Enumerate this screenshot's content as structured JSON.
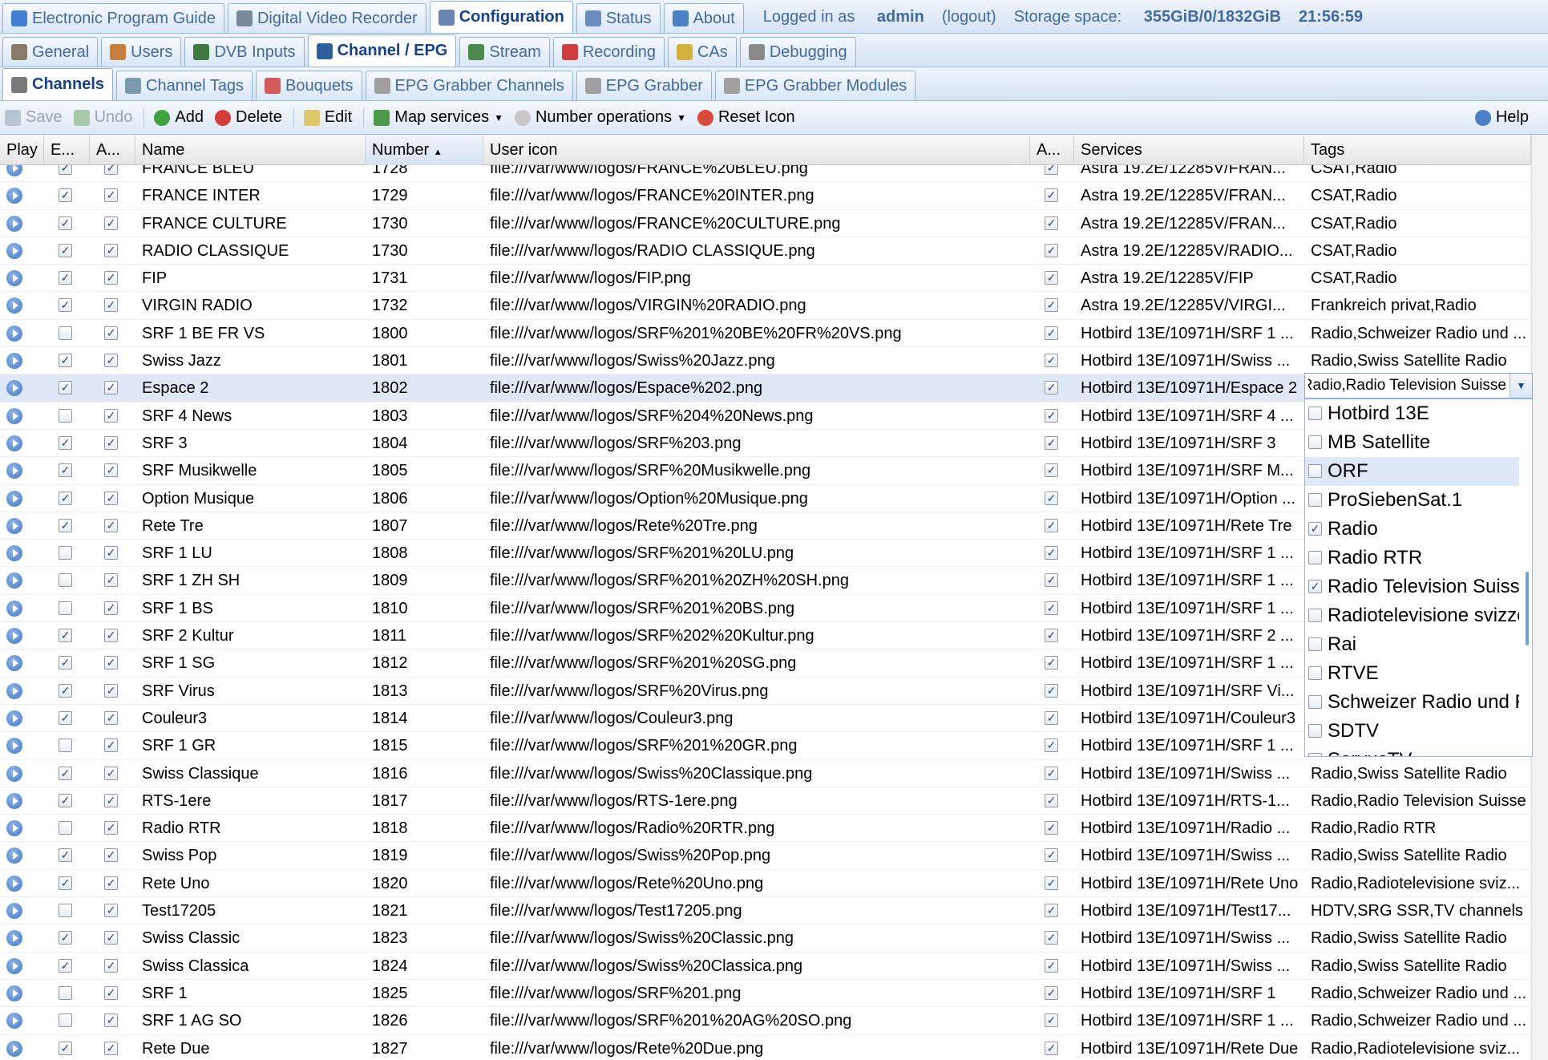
{
  "top_tabs": [
    {
      "label": "Electronic Program Guide",
      "icon": "epg-icon",
      "color": "#3f7fd4",
      "active": false
    },
    {
      "label": "Digital Video Recorder",
      "icon": "dvr-icon",
      "color": "#7a8a9a",
      "active": false
    },
    {
      "label": "Configuration",
      "icon": "wrench-icon",
      "color": "#6b85b5",
      "active": true
    },
    {
      "label": "Status",
      "icon": "eye-icon",
      "color": "#6a8cc0",
      "active": false
    },
    {
      "label": "About",
      "icon": "info-icon",
      "color": "#4a80c8",
      "active": false
    }
  ],
  "session": {
    "logged_in_prefix": "Logged in as",
    "user": "admin",
    "logout": "(logout)",
    "storage_label": "Storage space:",
    "storage_value": "355GiB/0/1832GiB",
    "time": "21:56:59"
  },
  "config_tabs": [
    {
      "label": "General",
      "icon": "tools-icon",
      "color": "#8a7a6a",
      "active": false
    },
    {
      "label": "Users",
      "icon": "users-icon",
      "color": "#c6803c",
      "active": false
    },
    {
      "label": "DVB Inputs",
      "icon": "dvb-icon",
      "color": "#3d7a3d",
      "active": false
    },
    {
      "label": "Channel / EPG",
      "icon": "tv-icon",
      "color": "#2d5f9a",
      "active": true
    },
    {
      "label": "Stream",
      "icon": "stream-icon",
      "color": "#4d8a4d",
      "active": false
    },
    {
      "label": "Recording",
      "icon": "rec-icon",
      "color": "#d43d3d",
      "active": false
    },
    {
      "label": "CAs",
      "icon": "key-icon",
      "color": "#d4b03d",
      "active": false
    },
    {
      "label": "Debugging",
      "icon": "bug-icon",
      "color": "#8a8a8a",
      "active": false
    }
  ],
  "channel_tabs": [
    {
      "label": "Channels",
      "icon": "remote-icon",
      "color": "#7a7a7a",
      "active": true
    },
    {
      "label": "Channel Tags",
      "icon": "tag-icon",
      "color": "#7a9ab0",
      "active": false
    },
    {
      "label": "Bouquets",
      "icon": "bouquet-icon",
      "color": "#d45a5a",
      "active": false
    },
    {
      "label": "EPG Grabber Channels",
      "icon": "grabber-icon",
      "color": "#a0a0a0",
      "active": false
    },
    {
      "label": "EPG Grabber",
      "icon": "grabber-icon",
      "color": "#a0a0a0",
      "active": false
    },
    {
      "label": "EPG Grabber Modules",
      "icon": "grabber-icon",
      "color": "#a0a0a0",
      "active": false
    }
  ],
  "toolbar": {
    "save": "Save",
    "undo": "Undo",
    "add": "Add",
    "delete": "Delete",
    "edit": "Edit",
    "map": "Map services",
    "number_ops": "Number operations",
    "reset_icon": "Reset Icon",
    "help": "Help"
  },
  "columns": {
    "play": "Play",
    "enabled": "E...",
    "autoname": "A...",
    "name": "Name",
    "number": "Number",
    "icon": "User icon",
    "auto_icon": "A...",
    "services": "Services",
    "tags": "Tags"
  },
  "rows": [
    {
      "e": true,
      "a": true,
      "name": "FRANCE BLEU",
      "num": "1728",
      "icon": "file:///var/www/logos/FRANCE%20BLEU.png",
      "ai": true,
      "svc": "Astra 19.2E/12285V/FRAN...",
      "tags": "CSAT,Radio"
    },
    {
      "e": true,
      "a": true,
      "name": "FRANCE INTER",
      "num": "1729",
      "icon": "file:///var/www/logos/FRANCE%20INTER.png",
      "ai": true,
      "svc": "Astra 19.2E/12285V/FRAN...",
      "tags": "CSAT,Radio"
    },
    {
      "e": true,
      "a": true,
      "name": "FRANCE CULTURE",
      "num": "1730",
      "icon": "file:///var/www/logos/FRANCE%20CULTURE.png",
      "ai": true,
      "svc": "Astra 19.2E/12285V/FRAN...",
      "tags": "CSAT,Radio"
    },
    {
      "e": true,
      "a": true,
      "name": "RADIO CLASSIQUE",
      "num": "1730",
      "icon": "file:///var/www/logos/RADIO CLASSIQUE.png",
      "ai": true,
      "svc": "Astra 19.2E/12285V/RADIO...",
      "tags": "CSAT,Radio"
    },
    {
      "e": true,
      "a": true,
      "name": "FIP",
      "num": "1731",
      "icon": "file:///var/www/logos/FIP.png",
      "ai": true,
      "svc": "Astra 19.2E/12285V/FIP",
      "tags": "CSAT,Radio"
    },
    {
      "e": true,
      "a": true,
      "name": "VIRGIN RADIO",
      "num": "1732",
      "icon": "file:///var/www/logos/VIRGIN%20RADIO.png",
      "ai": true,
      "svc": "Astra 19.2E/12285V/VIRGI...",
      "tags": "Frankreich privat,Radio"
    },
    {
      "e": false,
      "a": true,
      "name": "SRF 1 BE FR VS",
      "num": "1800",
      "icon": "file:///var/www/logos/SRF%201%20BE%20FR%20VS.png",
      "ai": true,
      "svc": "Hotbird 13E/10971H/SRF 1 ...",
      "tags": "Radio,Schweizer Radio und ..."
    },
    {
      "e": true,
      "a": true,
      "name": "Swiss Jazz",
      "num": "1801",
      "icon": "file:///var/www/logos/Swiss%20Jazz.png",
      "ai": true,
      "svc": "Hotbird 13E/10971H/Swiss ...",
      "tags": "Radio,Swiss Satellite Radio"
    },
    {
      "e": true,
      "a": true,
      "name": "Espace 2",
      "num": "1802",
      "icon": "file:///var/www/logos/Espace%202.png",
      "ai": true,
      "svc": "Hotbird 13E/10971H/Espace 2",
      "tags": "",
      "sel": true
    },
    {
      "e": false,
      "a": true,
      "name": "SRF 4 News",
      "num": "1803",
      "icon": "file:///var/www/logos/SRF%204%20News.png",
      "ai": true,
      "svc": "Hotbird 13E/10971H/SRF 4 ...",
      "tags": ""
    },
    {
      "e": true,
      "a": true,
      "name": "SRF 3",
      "num": "1804",
      "icon": "file:///var/www/logos/SRF%203.png",
      "ai": true,
      "svc": "Hotbird 13E/10971H/SRF 3",
      "tags": ""
    },
    {
      "e": true,
      "a": true,
      "name": "SRF Musikwelle",
      "num": "1805",
      "icon": "file:///var/www/logos/SRF%20Musikwelle.png",
      "ai": true,
      "svc": "Hotbird 13E/10971H/SRF M...",
      "tags": ""
    },
    {
      "e": true,
      "a": true,
      "name": "Option Musique",
      "num": "1806",
      "icon": "file:///var/www/logos/Option%20Musique.png",
      "ai": true,
      "svc": "Hotbird 13E/10971H/Option ...",
      "tags": ""
    },
    {
      "e": true,
      "a": true,
      "name": "Rete Tre",
      "num": "1807",
      "icon": "file:///var/www/logos/Rete%20Tre.png",
      "ai": true,
      "svc": "Hotbird 13E/10971H/Rete Tre",
      "tags": ""
    },
    {
      "e": false,
      "a": true,
      "name": "SRF 1 LU",
      "num": "1808",
      "icon": "file:///var/www/logos/SRF%201%20LU.png",
      "ai": true,
      "svc": "Hotbird 13E/10971H/SRF 1 ...",
      "tags": ""
    },
    {
      "e": false,
      "a": true,
      "name": "SRF 1 ZH SH",
      "num": "1809",
      "icon": "file:///var/www/logos/SRF%201%20ZH%20SH.png",
      "ai": true,
      "svc": "Hotbird 13E/10971H/SRF 1 ...",
      "tags": ""
    },
    {
      "e": false,
      "a": true,
      "name": "SRF 1 BS",
      "num": "1810",
      "icon": "file:///var/www/logos/SRF%201%20BS.png",
      "ai": true,
      "svc": "Hotbird 13E/10971H/SRF 1 ...",
      "tags": ""
    },
    {
      "e": true,
      "a": true,
      "name": "SRF 2 Kultur",
      "num": "1811",
      "icon": "file:///var/www/logos/SRF%202%20Kultur.png",
      "ai": true,
      "svc": "Hotbird 13E/10971H/SRF 2 ...",
      "tags": ""
    },
    {
      "e": true,
      "a": true,
      "name": "SRF 1 SG",
      "num": "1812",
      "icon": "file:///var/www/logos/SRF%201%20SG.png",
      "ai": true,
      "svc": "Hotbird 13E/10971H/SRF 1 ...",
      "tags": ""
    },
    {
      "e": true,
      "a": true,
      "name": "SRF Virus",
      "num": "1813",
      "icon": "file:///var/www/logos/SRF%20Virus.png",
      "ai": true,
      "svc": "Hotbird 13E/10971H/SRF Vi...",
      "tags": ""
    },
    {
      "e": true,
      "a": true,
      "name": "Couleur3",
      "num": "1814",
      "icon": "file:///var/www/logos/Couleur3.png",
      "ai": true,
      "svc": "Hotbird 13E/10971H/Couleur3",
      "tags": ""
    },
    {
      "e": false,
      "a": true,
      "name": "SRF 1 GR",
      "num": "1815",
      "icon": "file:///var/www/logos/SRF%201%20GR.png",
      "ai": true,
      "svc": "Hotbird 13E/10971H/SRF 1 ...",
      "tags": ""
    },
    {
      "e": true,
      "a": true,
      "name": "Swiss Classique",
      "num": "1816",
      "icon": "file:///var/www/logos/Swiss%20Classique.png",
      "ai": true,
      "svc": "Hotbird 13E/10971H/Swiss ...",
      "tags": "Radio,Swiss Satellite Radio"
    },
    {
      "e": true,
      "a": true,
      "name": "RTS-1ere",
      "num": "1817",
      "icon": "file:///var/www/logos/RTS-1ere.png",
      "ai": true,
      "svc": "Hotbird 13E/10971H/RTS-1...",
      "tags": "Radio,Radio Television Suisse"
    },
    {
      "e": false,
      "a": true,
      "name": "Radio RTR",
      "num": "1818",
      "icon": "file:///var/www/logos/Radio%20RTR.png",
      "ai": true,
      "svc": "Hotbird 13E/10971H/Radio ...",
      "tags": "Radio,Radio RTR"
    },
    {
      "e": true,
      "a": true,
      "name": "Swiss Pop",
      "num": "1819",
      "icon": "file:///var/www/logos/Swiss%20Pop.png",
      "ai": true,
      "svc": "Hotbird 13E/10971H/Swiss ...",
      "tags": "Radio,Swiss Satellite Radio"
    },
    {
      "e": true,
      "a": true,
      "name": "Rete Uno",
      "num": "1820",
      "icon": "file:///var/www/logos/Rete%20Uno.png",
      "ai": true,
      "svc": "Hotbird 13E/10971H/Rete Uno",
      "tags": "Radio,Radiotelevisione sviz..."
    },
    {
      "e": false,
      "a": true,
      "name": "Test17205",
      "num": "1821",
      "icon": "file:///var/www/logos/Test17205.png",
      "ai": true,
      "svc": "Hotbird 13E/10971H/Test17...",
      "tags": "HDTV,SRG SSR,TV channels"
    },
    {
      "e": true,
      "a": true,
      "name": "Swiss Classic",
      "num": "1823",
      "icon": "file:///var/www/logos/Swiss%20Classic.png",
      "ai": true,
      "svc": "Hotbird 13E/10971H/Swiss ...",
      "tags": "Radio,Swiss Satellite Radio"
    },
    {
      "e": true,
      "a": true,
      "name": "Swiss Classica",
      "num": "1824",
      "icon": "file:///var/www/logos/Swiss%20Classica.png",
      "ai": true,
      "svc": "Hotbird 13E/10971H/Swiss ...",
      "tags": "Radio,Swiss Satellite Radio"
    },
    {
      "e": false,
      "a": true,
      "name": "SRF 1",
      "num": "1825",
      "icon": "file:///var/www/logos/SRF%201.png",
      "ai": true,
      "svc": "Hotbird 13E/10971H/SRF 1",
      "tags": "Radio,Schweizer Radio und ..."
    },
    {
      "e": false,
      "a": true,
      "name": "SRF 1 AG SO",
      "num": "1826",
      "icon": "file:///var/www/logos/SRF%201%20AG%20SO.png",
      "ai": true,
      "svc": "Hotbird 13E/10971H/SRF 1 ...",
      "tags": "Radio,Schweizer Radio und ..."
    },
    {
      "e": true,
      "a": true,
      "name": "Rete Due",
      "num": "1827",
      "icon": "file:///var/www/logos/Rete%20Due.png",
      "ai": true,
      "svc": "Hotbird 13E/10971H/Rete Due",
      "tags": "Radio,Radiotelevisione sviz..."
    }
  ],
  "tag_editor": {
    "value": "Radio,Radio Television Suisse"
  },
  "tag_options": [
    {
      "label": "Hotbird 13E",
      "checked": false
    },
    {
      "label": "MB Satellite",
      "checked": false
    },
    {
      "label": "ORF",
      "checked": false,
      "highlighted": true
    },
    {
      "label": "ProSiebenSat.1",
      "checked": false
    },
    {
      "label": "Radio",
      "checked": true
    },
    {
      "label": "Radio RTR",
      "checked": false
    },
    {
      "label": "Radio Television Suisse",
      "checked": true
    },
    {
      "label": "Radiotelevisione svizzera",
      "checked": false
    },
    {
      "label": "Rai",
      "checked": false
    },
    {
      "label": "RTVE",
      "checked": false
    },
    {
      "label": "Schweizer Radio und Fernsehen",
      "checked": false
    },
    {
      "label": "SDTV",
      "checked": false
    },
    {
      "label": "ServusTV",
      "checked": false
    }
  ]
}
